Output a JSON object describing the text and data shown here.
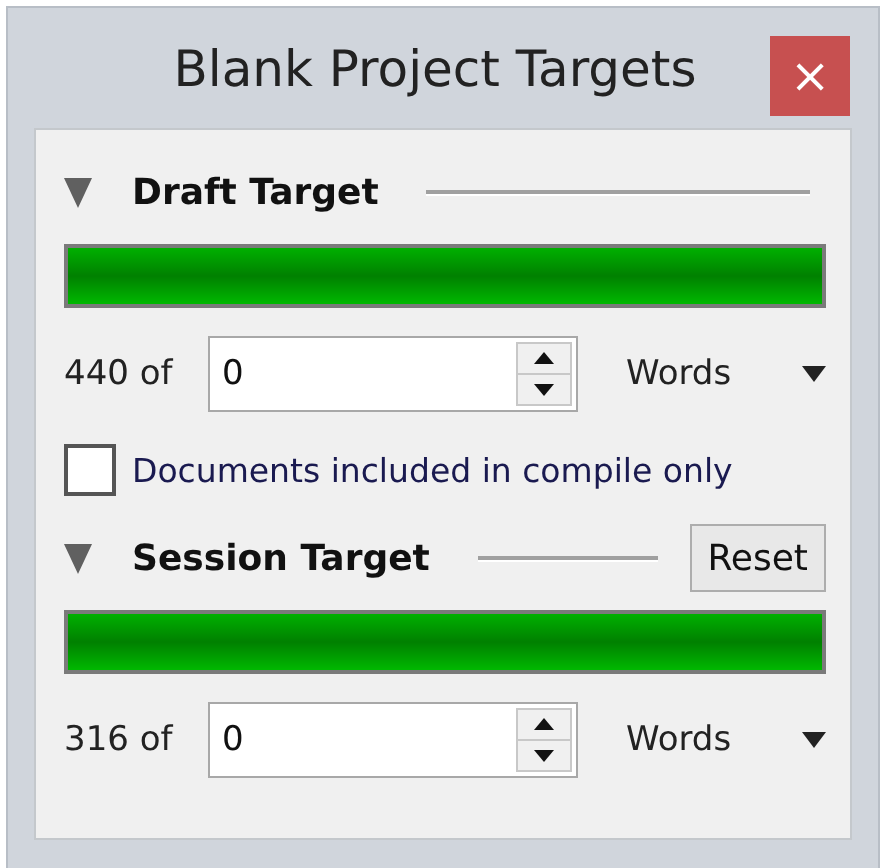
{
  "window": {
    "title": "Blank Project Targets",
    "close": "×"
  },
  "sections": [
    {
      "title": "Draft Target",
      "expanded": true,
      "level": 1,
      "count": "440 of",
      "value": "0",
      "unit": "Words",
      "checkbox": {
        "label": "Documents included in compile only",
        "checked": false
      }
    },
    {
      "title": "Session Target",
      "expanded": true,
      "level": 1,
      "count": "316 of",
      "value": "0",
      "unit": "Words",
      "button": "Reset"
    }
  ]
}
